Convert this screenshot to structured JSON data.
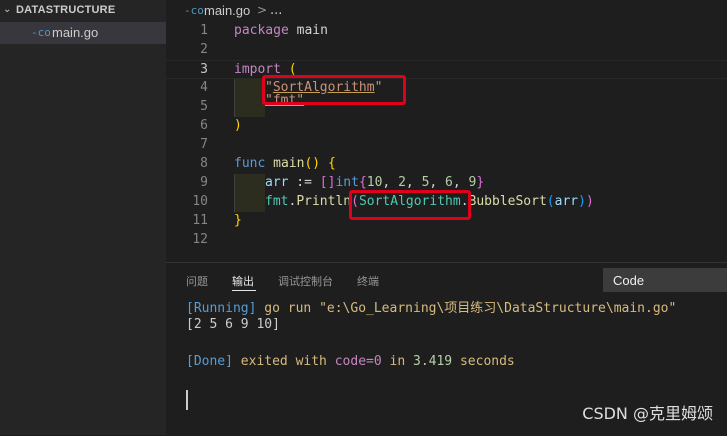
{
  "sidebar": {
    "section_title": "DATASTRUCTURE",
    "section_chevron": "⌄",
    "file": {
      "icon": "-co",
      "label": "main.go"
    }
  },
  "breadcrumb": {
    "icon": "-co",
    "file": "main.go",
    "separator": ">",
    "more": "..."
  },
  "editor": {
    "line_numbers": [
      "1",
      "2",
      "3",
      "4",
      "5",
      "6",
      "7",
      "8",
      "9",
      "10",
      "11",
      "12"
    ],
    "active_line": 3,
    "lines": {
      "l1": {
        "kw": "package",
        "rest": " main"
      },
      "l3": {
        "kw": "import",
        "paren": "("
      },
      "l4": {
        "q1": "\"",
        "pkg": "SortAlgorithm",
        "q2": "\""
      },
      "l5": {
        "pkg": "\"fmt\""
      },
      "l6": {
        "paren": ")"
      },
      "l8": {
        "kw": "func",
        "name": "main",
        "parens": "()",
        "brace": "{"
      },
      "l9": {
        "var": "arr",
        "op": " := ",
        "type": "[]int",
        "open": "{",
        "n1": "10",
        "n2": "2",
        "n3": "5",
        "n4": "6",
        "n5": "9",
        "close": "}"
      },
      "l10": {
        "pkg": "fmt",
        "dot": ".",
        "fn": "Println",
        "open": "(",
        "pkg2": "SortAlgorithm",
        "dot2": ".",
        "fn2": "BubbleSort",
        "open2": "(",
        "arg": "arr",
        "close2": ")",
        "close": ")"
      },
      "l11": {
        "brace": "}"
      }
    }
  },
  "panel": {
    "tabs": [
      "问题",
      "输出",
      "调试控制台",
      "终端"
    ],
    "active_tab": "输出",
    "channel": "Code",
    "output": {
      "running_tag": "[Running]",
      "running_cmd": " go run \"e:\\Go_Learning\\项目练习\\DataStructure\\main.go\"",
      "result": "[2 5 6 9 10]",
      "done_tag": "[Done]",
      "done_text": " exited with ",
      "done_code": "code=0",
      "done_in": " in ",
      "done_secs": "3.419",
      "done_seconds": " seconds"
    }
  },
  "watermark": "CSDN @克里姆颂",
  "colors": {
    "highlight_box": "#e0001b",
    "active_file_bg": "#37373d",
    "accent_go": "#519aba"
  }
}
